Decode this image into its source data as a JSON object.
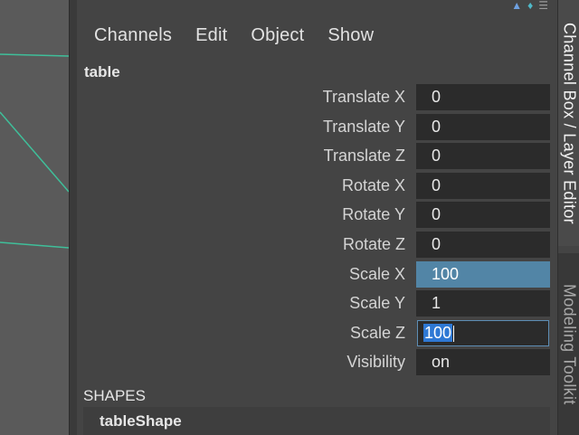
{
  "menu": [
    "Channels",
    "Edit",
    "Object",
    "Show"
  ],
  "object_name": "table",
  "channels": [
    {
      "label": "Translate X",
      "value": "0"
    },
    {
      "label": "Translate Y",
      "value": "0"
    },
    {
      "label": "Translate Z",
      "value": "0"
    },
    {
      "label": "Rotate X",
      "value": "0"
    },
    {
      "label": "Rotate Y",
      "value": "0"
    },
    {
      "label": "Rotate Z",
      "value": "0"
    },
    {
      "label": "Scale X",
      "value": "100"
    },
    {
      "label": "Scale Y",
      "value": "1"
    },
    {
      "label": "Scale Z",
      "value": "100"
    },
    {
      "label": "Visibility",
      "value": "on"
    }
  ],
  "shapes": {
    "header": "SHAPES",
    "items": [
      "tableShape"
    ]
  },
  "side_tabs": {
    "active": "Channel Box / Layer Editor",
    "inactive": "Modeling Toolkit"
  },
  "colors": {
    "selected_field": "#5285a6",
    "editing_highlight": "#2e78d4",
    "wire_lines": "#3fbf9a"
  },
  "icons": [
    "renderer-icon",
    "diamond-icon",
    "filter-icon"
  ]
}
